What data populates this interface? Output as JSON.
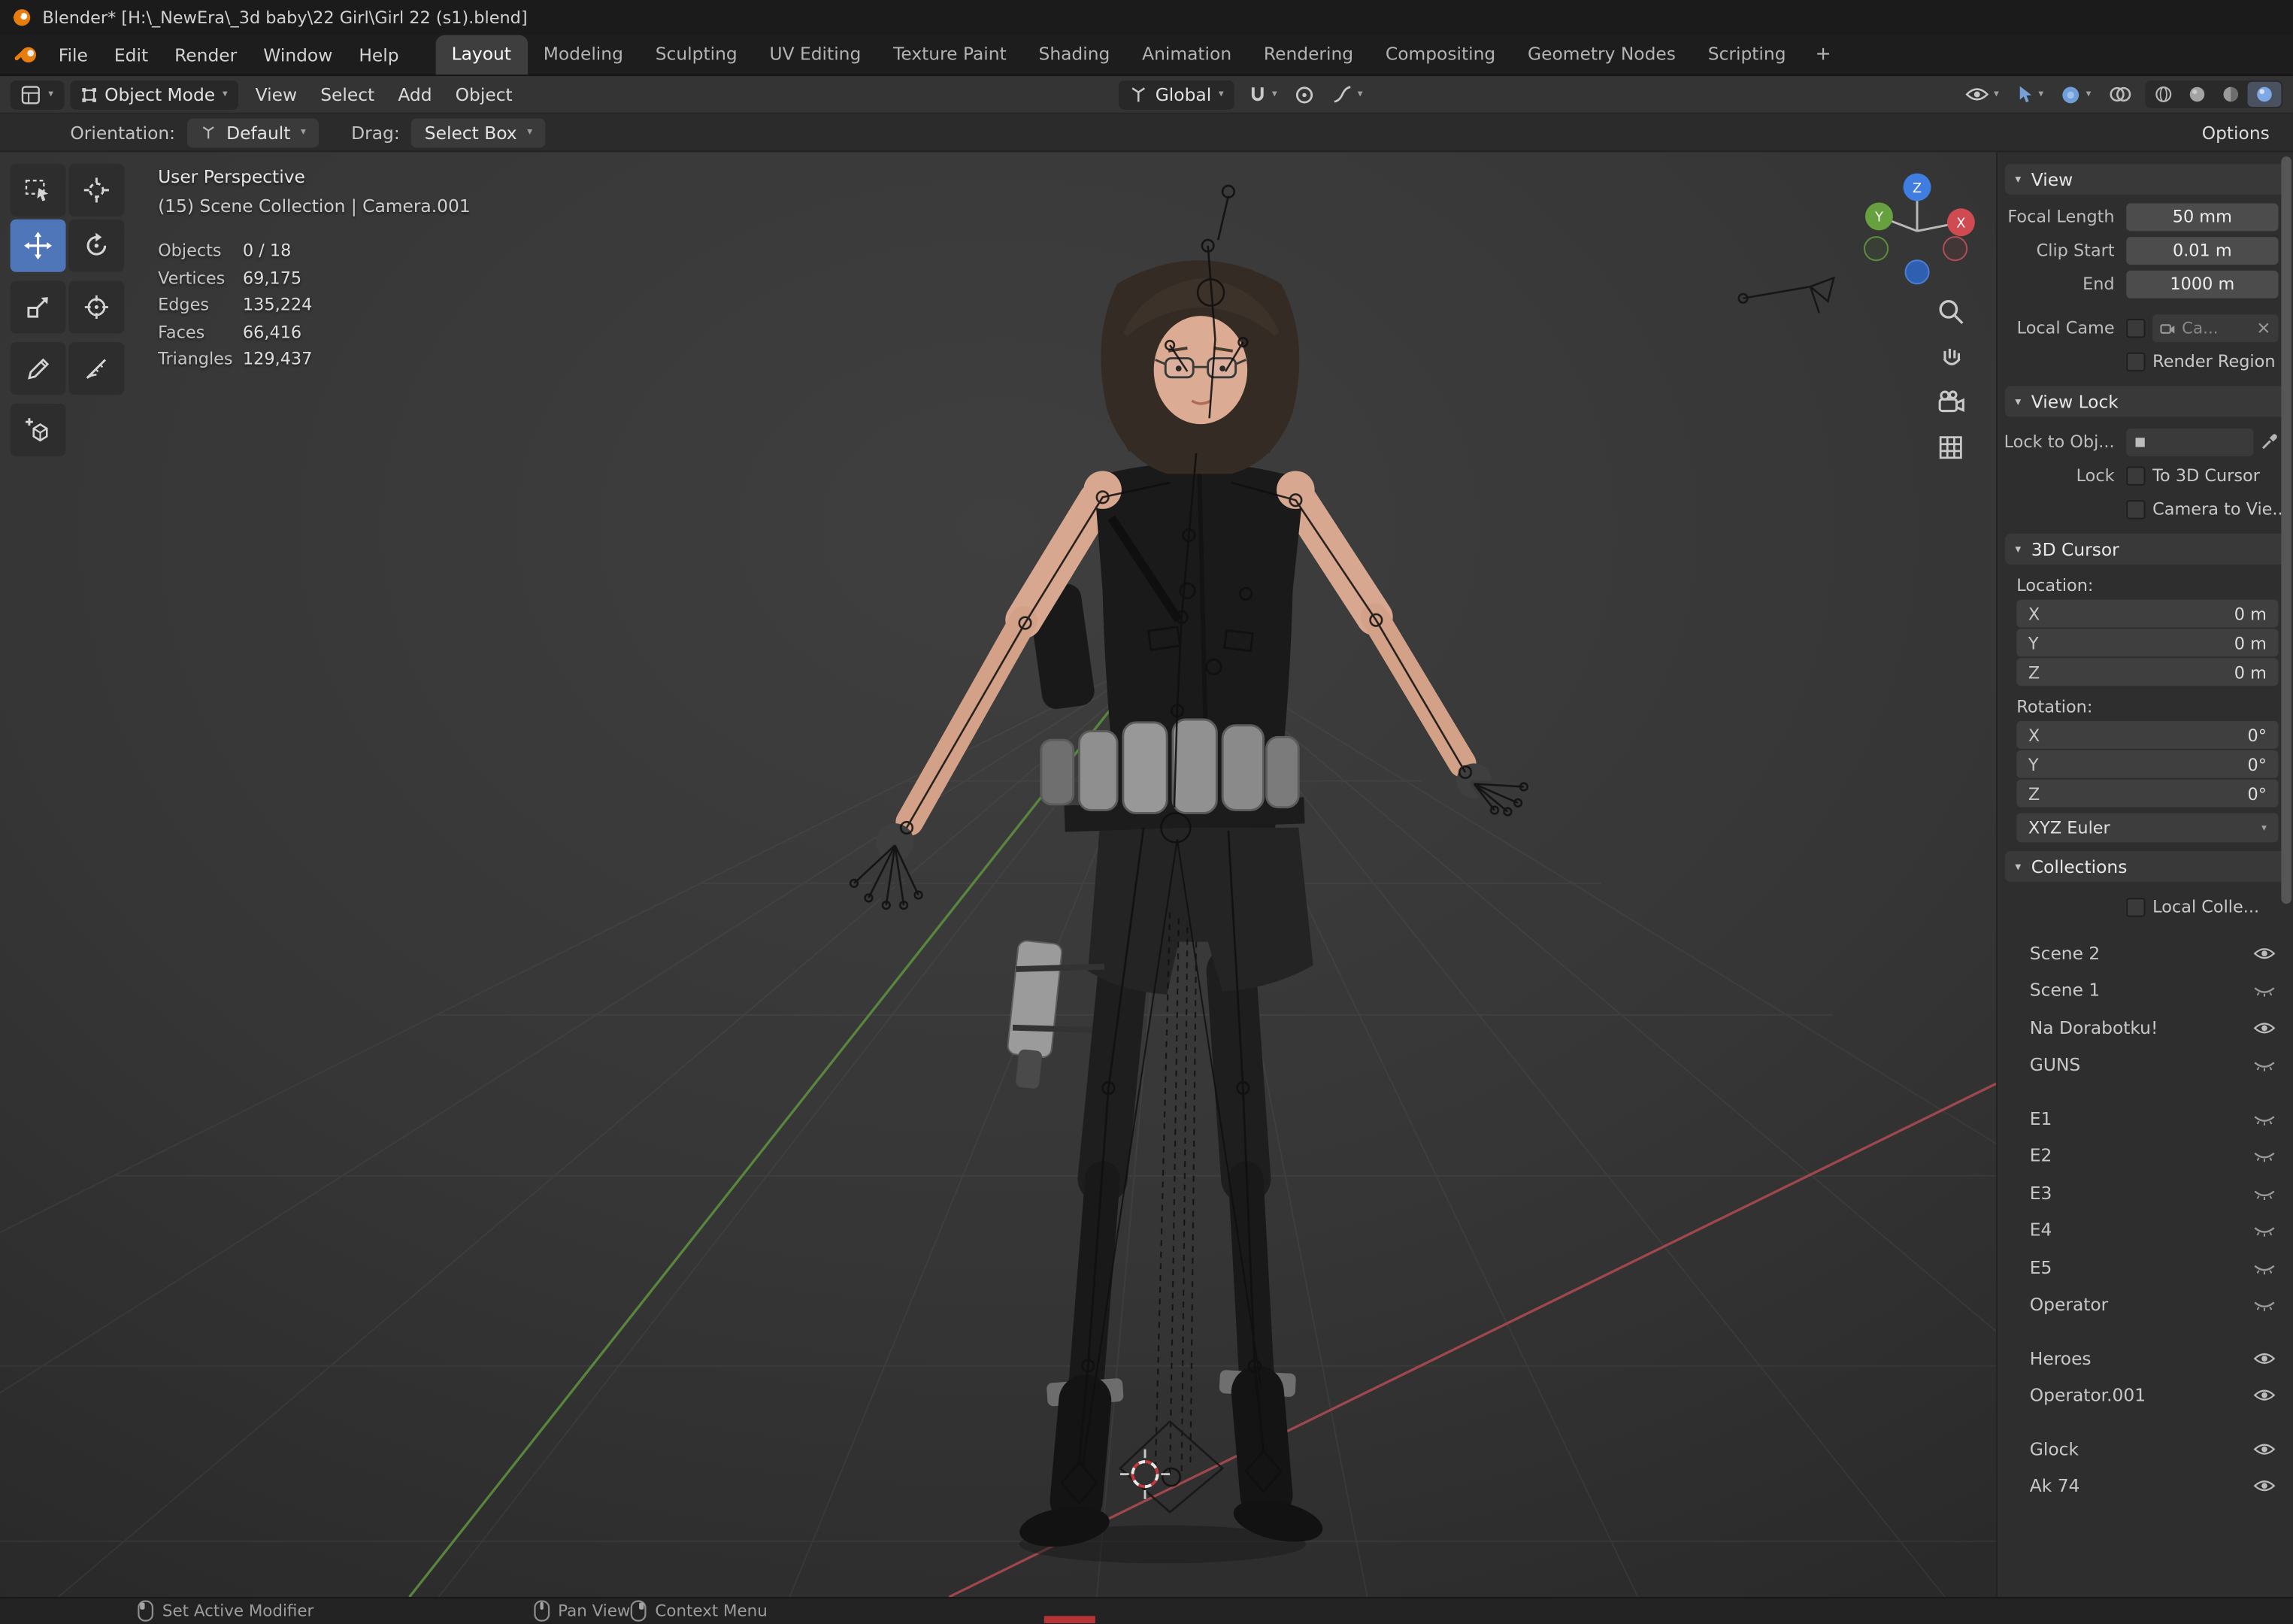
{
  "app": {
    "title": "Blender* [H:\\_NewEra\\_3d baby\\22 Girl\\Girl 22 (s1).blend]",
    "accent": "#4f76b8"
  },
  "topbar": {
    "menus": [
      "File",
      "Edit",
      "Render",
      "Window",
      "Help"
    ],
    "workspaces": [
      "Layout",
      "Modeling",
      "Sculpting",
      "UV Editing",
      "Texture Paint",
      "Shading",
      "Animation",
      "Rendering",
      "Compositing",
      "Geometry Nodes",
      "Scripting"
    ],
    "active_workspace": "Layout",
    "new_workspace": "+"
  },
  "viewport_header": {
    "mode": "Object Mode",
    "menus": [
      "View",
      "Select",
      "Add",
      "Object"
    ],
    "orientation": "Global"
  },
  "tool_settings": {
    "orientation_label": "Orientation:",
    "orientation_value": "Default",
    "drag_label": "Drag:",
    "drag_value": "Select Box",
    "options_label": "Options"
  },
  "overlay": {
    "perspective": "User Perspective",
    "scene": "(15) Scene Collection | Camera.001",
    "stats": [
      {
        "label": "Objects",
        "value": "0 / 18"
      },
      {
        "label": "Vertices",
        "value": "69,175"
      },
      {
        "label": "Edges",
        "value": "135,224"
      },
      {
        "label": "Faces",
        "value": "66,416"
      },
      {
        "label": "Triangles",
        "value": "129,437"
      }
    ]
  },
  "gizmo": {
    "x": "X",
    "y": "Y",
    "z": "Z"
  },
  "icons": {
    "header_right": [
      "visibility-dropdown",
      "show-gizmo-dropdown",
      "show-overlays-dropdown",
      "toggle-xray",
      "shading-wireframe",
      "shading-solid",
      "shading-material",
      "shading-rendered"
    ],
    "viewport_nav": [
      "zoom",
      "pan-hand",
      "camera-view",
      "orthographic-grid"
    ]
  },
  "sidebar": {
    "view_panel": {
      "title": "View",
      "fields": [
        {
          "label": "Focal Length",
          "value": "50 mm"
        },
        {
          "label": "Clip Start",
          "value": "0.01 m"
        },
        {
          "label": "End",
          "value": "1000 m"
        }
      ],
      "local_camera": {
        "label": "Local Came",
        "value": "Ca...",
        "clear": "×"
      },
      "render_region": "Render Region"
    },
    "view_lock_panel": {
      "title": "View Lock",
      "lock_to_object": "Lock to Obj...",
      "lock_label": "Lock",
      "to_3d_cursor": "To 3D Cursor",
      "camera_to_view": "Camera to Vie..."
    },
    "cursor_panel": {
      "title": "3D Cursor",
      "location_label": "Location:",
      "location": [
        {
          "axis": "X",
          "value": "0 m"
        },
        {
          "axis": "Y",
          "value": "0 m"
        },
        {
          "axis": "Z",
          "value": "0 m"
        }
      ],
      "rotation_label": "Rotation:",
      "rotation": [
        {
          "axis": "X",
          "value": "0°"
        },
        {
          "axis": "Y",
          "value": "0°"
        },
        {
          "axis": "Z",
          "value": "0°"
        }
      ],
      "rotation_mode": "XYZ Euler"
    },
    "collections_panel": {
      "title": "Collections",
      "local_collections": "Local Colle...",
      "items": [
        {
          "name": "Scene 2",
          "visible": true,
          "section": 1
        },
        {
          "name": "Scene 1",
          "visible": false,
          "section": 1
        },
        {
          "name": "Na Dorabotku!",
          "visible": true,
          "section": 1
        },
        {
          "name": "GUNS",
          "visible": false,
          "section": 1
        },
        {
          "name": "E1",
          "visible": false,
          "section": 2
        },
        {
          "name": "E2",
          "visible": false,
          "section": 2
        },
        {
          "name": "E3",
          "visible": false,
          "section": 2
        },
        {
          "name": "E4",
          "visible": false,
          "section": 2
        },
        {
          "name": "E5",
          "visible": false,
          "section": 2
        },
        {
          "name": "Operator",
          "visible": false,
          "section": 2
        },
        {
          "name": "Heroes",
          "visible": true,
          "section": 3
        },
        {
          "name": "Operator.001",
          "visible": true,
          "section": 3
        },
        {
          "name": "Glock",
          "visible": true,
          "section": 4
        },
        {
          "name": "Ak 74",
          "visible": true,
          "section": 4
        }
      ]
    }
  },
  "statusbar": {
    "items": [
      {
        "mouse": "left",
        "label": "Set Active Modifier"
      },
      {
        "mouse": "middle",
        "label": "Pan View"
      },
      {
        "mouse": "right",
        "label": "Context Menu"
      }
    ]
  }
}
